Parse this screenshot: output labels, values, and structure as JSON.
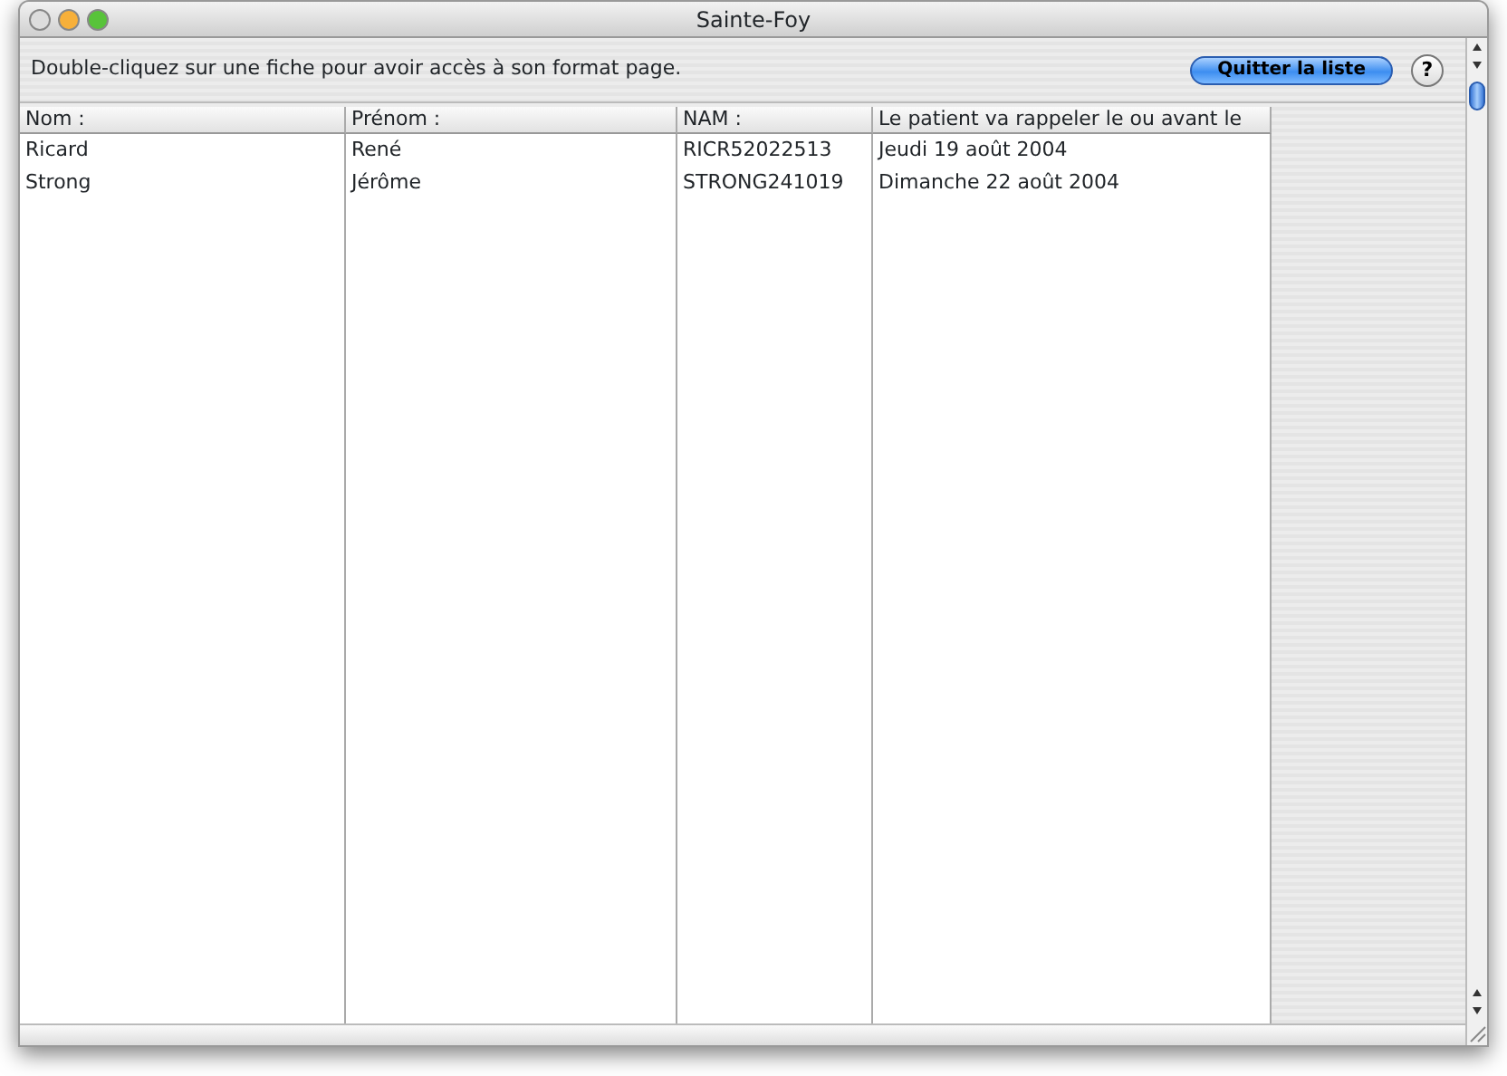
{
  "window": {
    "title": "Sainte-Foy"
  },
  "instruction": "Double-cliquez sur une fiche pour avoir accès à son format page.",
  "buttons": [
    {
      "label": "Quitter la liste",
      "kind": "primary"
    },
    {
      "label": "?",
      "kind": "help"
    }
  ],
  "table": {
    "columns": [
      "Nom :",
      "Prénom :",
      "NAM :",
      "Le patient va rappeler le ou avant le"
    ],
    "rows": [
      [
        "Ricard",
        "René",
        "RICR52022513",
        "Jeudi 19 août 2004"
      ],
      [
        "Strong",
        "Jérôme",
        "STRONG241019",
        "Dimanche 22 août 2004"
      ]
    ]
  }
}
